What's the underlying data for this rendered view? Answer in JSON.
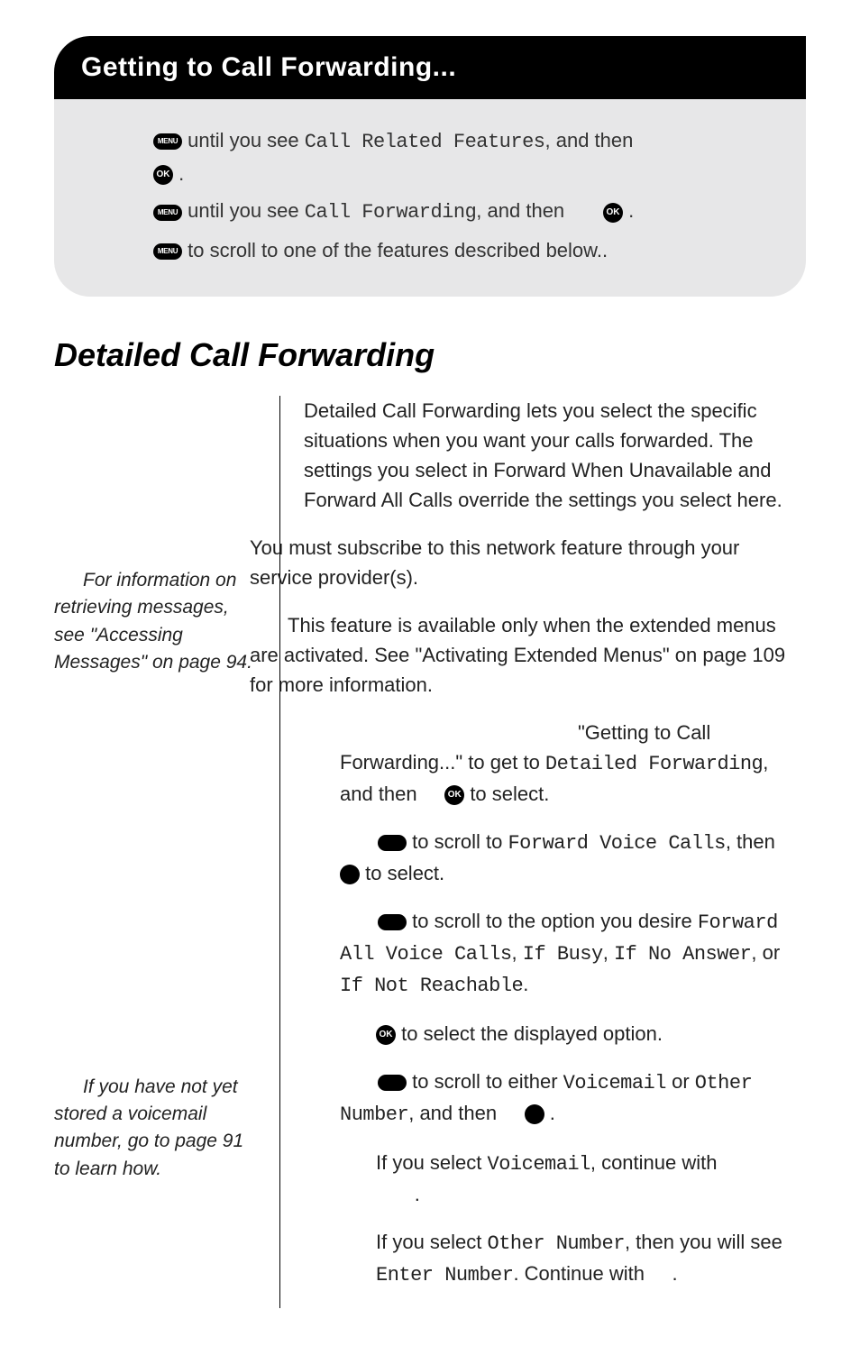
{
  "header": {
    "title": "Getting to Call Forwarding..."
  },
  "greybox": {
    "line1_pre": " until you see ",
    "line1_lcd": "Call Related Features",
    "line1_post": ", and then ",
    "line1_end": " .",
    "line2_pre": " until you see ",
    "line2_lcd": "Call Forwarding",
    "line2_post": ", and then ",
    "line2_end": " .",
    "line3": " to scroll to one of the features described below.."
  },
  "icons": {
    "menu": "MENU",
    "ok": "OK"
  },
  "section_title": "Detailed Call Forwarding",
  "sidebar": {
    "note1": "For information on retrieving messages, see \"Accessing Messages\" on page 94.",
    "note2": "If you have not yet stored a voicemail number, go to page 91 to learn how."
  },
  "main": {
    "p1": "Detailed Call Forwarding lets you select the specific situations when you want your calls forwarded. The settings you select in Forward When Unavailable and Forward All Calls override the settings you select here.",
    "p2": "You must subscribe to this network feature through your service provider(s).",
    "p3": "This feature is available only when the extended menus are activated. See \"Activating Extended Menus\" on page 109 for more information.",
    "step1_a": "\"Getting to Call Forwarding...\" to get to ",
    "step1_lcd": "Detailed Forwarding",
    "step1_b": ", and then ",
    "step1_c": " to select.",
    "step2_a": " to scroll to ",
    "step2_lcd": "Forward Voice Calls",
    "step2_b": ", then ",
    "step2_c": " to select.",
    "step3_a": " to scroll to the option you desire ",
    "step3_lcd1": "Forward All Voice Calls",
    "step3_comma1": ", ",
    "step3_lcd2": "If Busy",
    "step3_comma2": ", ",
    "step3_lcd3": "If No Answer",
    "step3_or": ", or ",
    "step3_lcd4": "If Not Reachable",
    "step3_end": ".",
    "step4_a": " to select the displayed option.",
    "step5_a": " to scroll to either ",
    "step5_lcd1": "Voicemail",
    "step5_or": " or ",
    "step5_lcd2": "Other Number",
    "step5_b": ", and then ",
    "step5_c": " .",
    "step5_if1a": "If you select ",
    "step5_if1lcd": "Voicemail",
    "step5_if1b": ", continue with ",
    "step5_if1c": ".",
    "step5_if2a": "If you select ",
    "step5_if2lcd": "Other Number",
    "step5_if2b": ", then you will see ",
    "step5_if2lcd2": "Enter Number",
    "step5_if2c": ". Continue with ",
    "step5_if2d": "."
  }
}
